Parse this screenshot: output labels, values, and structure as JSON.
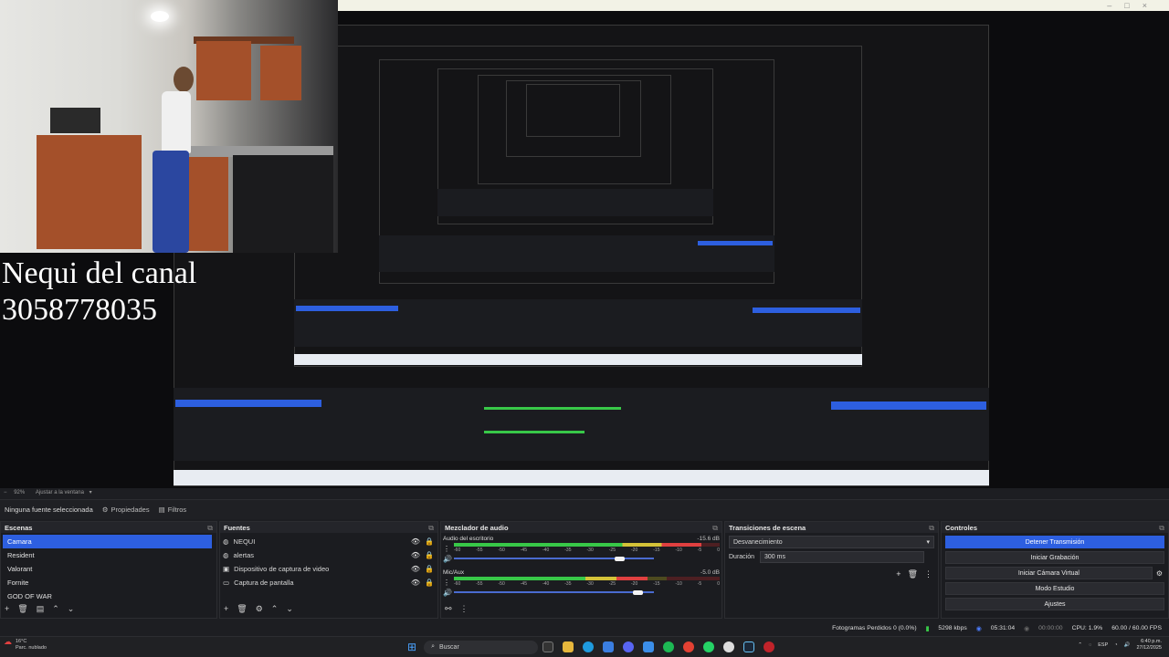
{
  "preview": {
    "overlay_line1": "Nequi del canal",
    "overlay_line2": "3058778035"
  },
  "zoom_row": {
    "zoom": "92%",
    "fit": "Ajustar a la ventana"
  },
  "source_bar": {
    "selected": "Ninguna fuente seleccionada",
    "properties": "Propiedades",
    "filters": "Filtros"
  },
  "scenes": {
    "title": "Escenas",
    "items": [
      "Camara",
      "Resident",
      "Valorant",
      "Fornite",
      "GOD OF WAR"
    ],
    "selected_index": 0
  },
  "sources": {
    "title": "Fuentes",
    "items": [
      "NEQUI",
      "alertas",
      "Dispositivo de captura de video",
      "Captura de pantalla"
    ]
  },
  "mixer": {
    "title": "Mezclador de audio",
    "channels": [
      {
        "name": "Audio del escritorio",
        "db": "-15.6 dB",
        "level": 0.93,
        "volume": 0.89
      },
      {
        "name": "Mic/Aux",
        "db": "-5.0 dB",
        "level": 0.73,
        "volume": 0.99
      }
    ],
    "ticks": [
      "-60",
      "-55",
      "-50",
      "-45",
      "-40",
      "-35",
      "-30",
      "-25",
      "-20",
      "-15",
      "-10",
      "-5",
      "0"
    ]
  },
  "transitions": {
    "title": "Transiciones de escena",
    "selected": "Desvanecimiento",
    "duration_label": "Duración",
    "duration_value": "300 ms"
  },
  "controls": {
    "title": "Controles",
    "buttons": [
      "Detener Transmisión",
      "Iniciar Grabación",
      "Iniciar Cámara Virtual",
      "Modo Estudio",
      "Ajustes"
    ]
  },
  "status": {
    "dropped": "Fotogramas Perdidos 0 (0.0%)",
    "kbps": "5298 kbps",
    "stream_time": "05:31:04",
    "rec_time": "00:00:00",
    "cpu": "CPU: 1.9%",
    "fps": "60.00 / 60.00 FPS"
  },
  "taskbar": {
    "weather_temp": "16°C",
    "weather_desc": "Parc. nublado",
    "search": "Buscar",
    "lang": "ESP",
    "time": "6:40 p.m.",
    "date": "27/12/2025"
  },
  "colors": {
    "accent": "#2d5fe0",
    "panel": "#1b1c20",
    "meter_green": "#38c848",
    "meter_yellow": "#d4c238",
    "meter_red": "#e04040"
  }
}
